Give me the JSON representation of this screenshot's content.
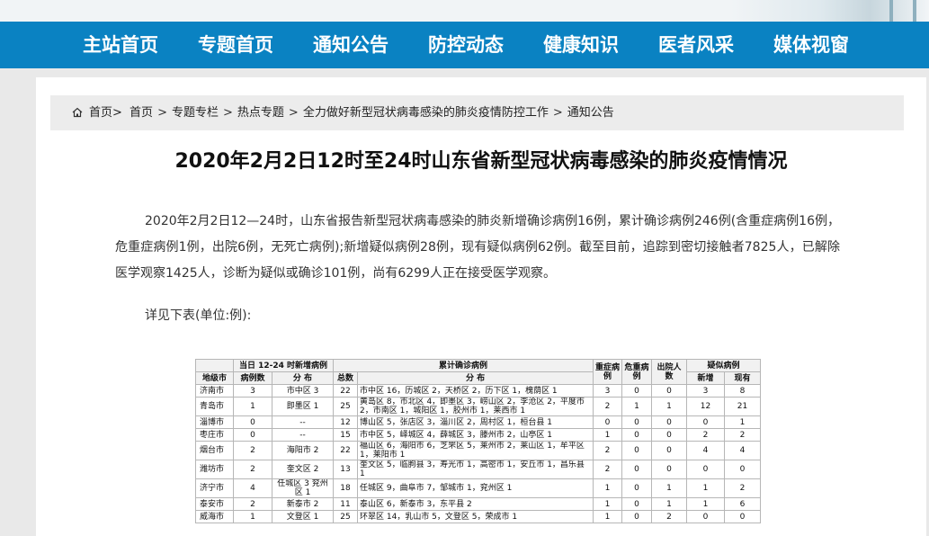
{
  "nav": {
    "items": [
      "主站首页",
      "专题首页",
      "通知公告",
      "防控动态",
      "健康知识",
      "医者风采",
      "媒体视窗"
    ]
  },
  "breadcrumb": {
    "items": [
      "首页>",
      "首页",
      "专题专栏",
      "热点专题",
      "全力做好新型冠状病毒感染的肺炎疫情防控工作",
      "通知公告"
    ],
    "separator": ">"
  },
  "article": {
    "title": "2020年2月2日12时至24时山东省新型冠状病毒感染的肺炎疫情情况",
    "paragraph": "2020年2月2日12—24时，山东省报告新型冠状病毒感染的肺炎新增确诊病例16例，累计确诊病例246例(含重症病例16例，危重症病例1例，出院6例，无死亡病例);新增疑似病例28例，现有疑似病例62例。截至目前，追踪到密切接触者7825人，已解除医学观察1425人，诊断为疑似或确诊101例，尚有6299人正在接受医学观察。",
    "detail_line": "详见下表(单位:例):"
  },
  "table": {
    "header_top": {
      "group_new": "当日 12-24 时新增病例",
      "group_total": "累计确诊病例",
      "severe": "重症病例",
      "critical": "危重病例",
      "discharged": "出院人数",
      "group_suspect": "疑似病例"
    },
    "header_sub": {
      "city": "地级市",
      "new_count": "病例数",
      "new_dist": "分 布",
      "total": "总数",
      "total_dist": "分 布",
      "suspect_new": "新增",
      "suspect_now": "现有"
    },
    "rows": [
      {
        "city": "济南市",
        "new": "3",
        "new_dist": "市中区 3",
        "total": "22",
        "dist": "市中区 16，历城区 2，天桥区 2，历下区 1，槐荫区 1",
        "severe": "3",
        "critical": "0",
        "discharged": "0",
        "s_new": "3",
        "s_now": "8"
      },
      {
        "city": "青岛市",
        "new": "1",
        "new_dist": "即墨区 1",
        "total": "25",
        "dist": "黄岛区 8，市北区 4，即墨区 3，崂山区 2，李沧区 2，平度市 2，市南区 1，城阳区 1，胶州市 1，莱西市 1",
        "severe": "2",
        "critical": "1",
        "discharged": "1",
        "s_new": "12",
        "s_now": "21"
      },
      {
        "city": "淄博市",
        "new": "0",
        "new_dist": "--",
        "total": "12",
        "dist": "博山区 5，张店区 3，淄川区 2，周村区 1，桓台县 1",
        "severe": "0",
        "critical": "0",
        "discharged": "0",
        "s_new": "0",
        "s_now": "1"
      },
      {
        "city": "枣庄市",
        "new": "0",
        "new_dist": "--",
        "total": "15",
        "dist": "市中区 5，峄城区 4，薛城区 3，滕州市 2，山亭区 1",
        "severe": "1",
        "critical": "0",
        "discharged": "0",
        "s_new": "2",
        "s_now": "2"
      },
      {
        "city": "烟台市",
        "new": "2",
        "new_dist": "海阳市 2",
        "total": "22",
        "dist": "福山区 6，海阳市 6，芝罘区 5，莱州市 2，莱山区 1，牟平区 1，莱阳市 1",
        "severe": "2",
        "critical": "0",
        "discharged": "0",
        "s_new": "4",
        "s_now": "4"
      },
      {
        "city": "潍坊市",
        "new": "2",
        "new_dist": "奎文区 2",
        "total": "13",
        "dist": "奎文区 5，临朐县 3，寿光市 1，高密市 1，安丘市 1，昌乐县 1",
        "severe": "2",
        "critical": "0",
        "discharged": "0",
        "s_new": "0",
        "s_now": "0"
      },
      {
        "city": "济宁市",
        "new": "4",
        "new_dist": "任城区 3 兖州区 1",
        "total": "18",
        "dist": "任城区 9，曲阜市 7，邹城市 1，兖州区 1",
        "severe": "1",
        "critical": "0",
        "discharged": "1",
        "s_new": "1",
        "s_now": "2"
      },
      {
        "city": "泰安市",
        "new": "2",
        "new_dist": "新泰市 2",
        "total": "11",
        "dist": "泰山区 6，新泰市 3，东平县 2",
        "severe": "1",
        "critical": "0",
        "discharged": "1",
        "s_new": "1",
        "s_now": "6"
      },
      {
        "city": "威海市",
        "new": "1",
        "new_dist": "文登区 1",
        "total": "25",
        "dist": "环翠区 14，乳山市 5，文登区 5，荣成市 1",
        "severe": "1",
        "critical": "0",
        "discharged": "2",
        "s_new": "0",
        "s_now": "0"
      }
    ]
  }
}
